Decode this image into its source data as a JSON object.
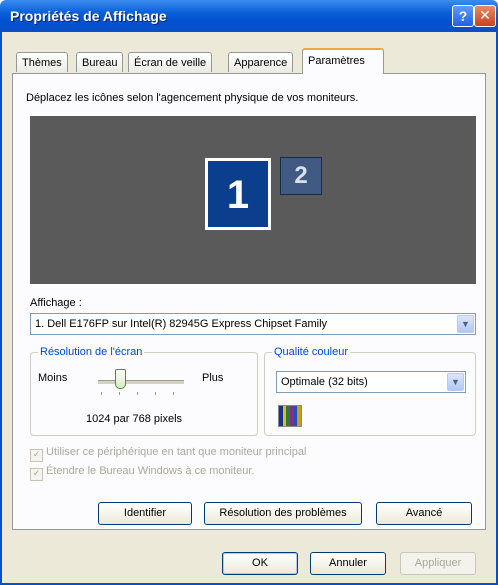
{
  "window": {
    "title": "Propriétés de Affichage",
    "help_glyph": "?",
    "close_glyph": "✕"
  },
  "tabs": [
    {
      "label": "Thèmes",
      "active": false
    },
    {
      "label": "Bureau",
      "active": false
    },
    {
      "label": "Écran de veille",
      "active": false
    },
    {
      "label": "Apparence",
      "active": false
    },
    {
      "label": "Paramètres",
      "active": true
    }
  ],
  "settings": {
    "instruction": "Déplacez les icônes selon l'agencement physique de vos moniteurs.",
    "monitors": [
      {
        "number": "1",
        "selected": true
      },
      {
        "number": "2",
        "selected": false
      }
    ],
    "display_label": "Affichage :",
    "display_value": "1. Dell E176FP sur Intel(R) 82945G Express Chipset Family",
    "resolution": {
      "legend": "Résolution de l'écran",
      "less": "Moins",
      "more": "Plus",
      "value": "1024 par 768 pixels",
      "slider_level": 0.25
    },
    "color_quality": {
      "legend": "Qualité couleur",
      "value": "Optimale (32 bits)",
      "swatch_colors": [
        "#1f2f8f",
        "#d8c020",
        "#2e7a3a",
        "#8a2a8a",
        "#2050c0",
        "#c0a020"
      ]
    },
    "checkboxes": [
      {
        "label": "Utiliser ce périphérique en tant que moniteur principal",
        "checked": true,
        "enabled": false
      },
      {
        "label": "Étendre le Bureau Windows à ce moniteur.",
        "checked": true,
        "enabled": false
      }
    ],
    "buttons": {
      "identify": "Identifier",
      "troubleshoot": "Résolution des problèmes",
      "advanced": "Avancé"
    }
  },
  "dialog_buttons": {
    "ok": "OK",
    "cancel": "Annuler",
    "apply": "Appliquer"
  },
  "colors": {
    "titlebar": "#0050d0",
    "monitor_area": "#5a5a5a",
    "monitor_selected": "#0b3e8c",
    "group_legend": "#0046d5"
  }
}
